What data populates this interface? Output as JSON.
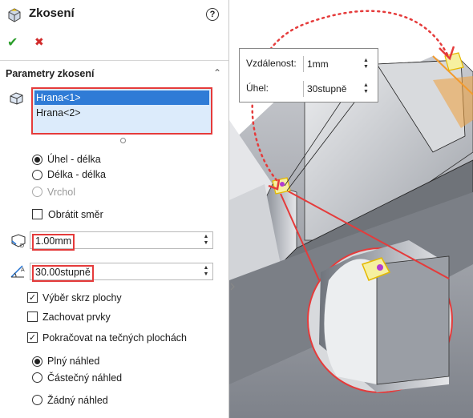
{
  "header": {
    "title": "Zkosení",
    "help_label": "?"
  },
  "actions": {
    "ok": "✔",
    "cancel": "✖"
  },
  "section": {
    "title": "Parametry zkosení"
  },
  "selection": {
    "items": [
      "Hrana<1>",
      "Hrana<2>"
    ]
  },
  "type_options": [
    {
      "label": "Úhel - délka",
      "selected": true,
      "enabled": true
    },
    {
      "label": "Délka - délka",
      "selected": false,
      "enabled": true
    },
    {
      "label": "Vrchol",
      "selected": false,
      "enabled": false
    }
  ],
  "flip_direction": {
    "label": "Obrátit směr",
    "checked": false
  },
  "distance": {
    "value": "1.00mm"
  },
  "angle": {
    "value": "30.00stupně"
  },
  "options": [
    {
      "label": "Výběr skrz plochy",
      "checked": true
    },
    {
      "label": "Zachovat prvky",
      "checked": false
    },
    {
      "label": "Pokračovat na tečných plochách",
      "checked": true
    }
  ],
  "preview_options": [
    {
      "label": "Plný náhled",
      "selected": true
    },
    {
      "label": "Částečný náhled",
      "selected": false
    },
    {
      "label": "Žádný náhled",
      "selected": false
    }
  ],
  "callout": {
    "distance_label": "Vzdálenost:",
    "distance_value": "1mm",
    "angle_label": "Úhel:",
    "angle_value": "30stupně"
  },
  "colors": {
    "highlight": "#e53b3b",
    "selection": "#2f7bd6",
    "ok": "#2a9d2a",
    "cancel": "#d12b2b"
  }
}
